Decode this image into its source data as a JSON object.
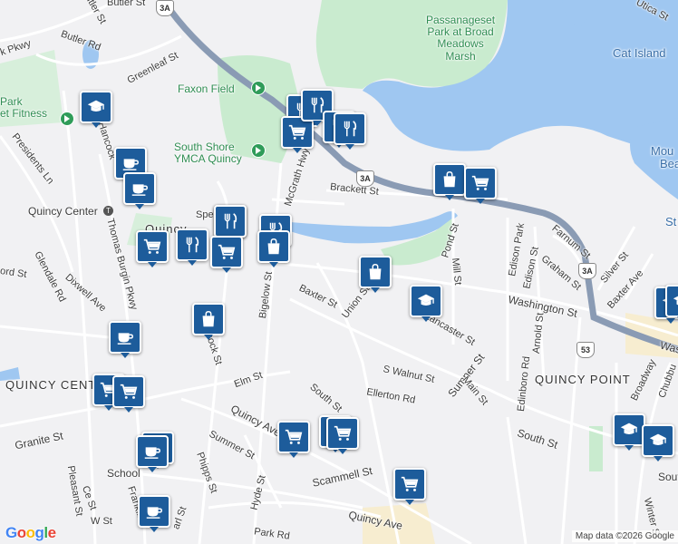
{
  "attribution": "Map data ©2026 Google",
  "logo": [
    "G",
    "o",
    "o",
    "g",
    "l",
    "e"
  ],
  "shields": {
    "3a_top": "3A",
    "3a_mid": "3A",
    "3a_right": "3A",
    "53": "53"
  },
  "areas": {
    "quincy_center": "Quincy Center",
    "quincy": "Quincy",
    "quincy_center2": "QUINCY CENTER",
    "quincy_point": "QUINCY POINT"
  },
  "parks": {
    "passanageset": "Passanageset\nPark at Broad\nMeadows\nMarsh",
    "faxon": "Faxon Field",
    "ymca": "South Shore\nYMCA Quincy",
    "fitness": "Park\net Fitness"
  },
  "water": {
    "cat_island": "Cat Island",
    "mou": "Mou",
    "bea": "Bea",
    "st": "St"
  },
  "streets": {
    "butler_st": "Butler St",
    "butler_rd": "Butler Rd",
    "k_pkwy": "k Pkwy",
    "greenleaf": "Greenleaf St",
    "hancock": "Hancock",
    "presidents": "Presidents Ln",
    "thomas_burgin": "Thomas Burgin Pkwy",
    "mcgrath": "McGrath Hwy",
    "brackett": "Brackett St",
    "washington": "Washington St",
    "washington2": "Wash",
    "pond": "Pond St",
    "mill": "Mill St",
    "edison_park": "Edison Park",
    "edison": "Edison St",
    "farnum": "Farnum St",
    "graham": "Graham St",
    "silver": "Silver St",
    "baxter_ave": "Baxter Ave",
    "baxter_st": "Baxter St",
    "union": "Union St",
    "bigelow": "Bigelow St",
    "lancaster": "Lancaster St",
    "s_walnut": "S Walnut St",
    "sumner": "Sumner St",
    "main": "Main St",
    "ellerton": "Ellerton Rd",
    "arnold": "Arnold St",
    "edinboro": "Edinboro Rd",
    "broadway": "Broadway",
    "chubbuck": "Chubbu",
    "south_st": "South St",
    "south_st2": "South St",
    "south_right": "South",
    "elm": "Elm St",
    "quincy_ave": "Quincy Ave",
    "quincy_ave2": "Quincy Ave",
    "summer": "Summer St",
    "phipps": "Phipps St",
    "hyde": "Hyde St",
    "scammell": "Scammell St",
    "school": "School",
    "granite": "Granite St",
    "pleasant": "Pleasant St",
    "franklin": "Franklin",
    "park_rd": "Park Rd",
    "winter": "Winter St",
    "glendale": "Glendale Rd",
    "dixwell": "Dixwell Ave",
    "ford": "ord St",
    "hancock_st": "Hancock St",
    "utica": "Utica St",
    "spear": "Spe",
    "carl": "arl St",
    "centre": "Ce St",
    "ws": "W St"
  },
  "markers": [
    {
      "type": "school-icon"
    },
    {
      "type": "coffee-icon"
    },
    {
      "type": "coffee-icon"
    },
    {
      "type": "school-icon"
    },
    {
      "type": "restaurant-icon"
    },
    {
      "type": "shopping-cart-icon"
    },
    {
      "type": "restaurant-icon"
    },
    {
      "type": "restaurant-icon"
    },
    {
      "type": "shopping-bag-icon"
    },
    {
      "type": "shopping-cart-icon"
    },
    {
      "type": "restaurant-icon"
    },
    {
      "type": "shopping-bag-icon"
    },
    {
      "type": "shopping-cart-icon"
    },
    {
      "type": "restaurant-icon"
    },
    {
      "type": "restaurant-icon"
    },
    {
      "type": "shopping-cart-icon"
    },
    {
      "type": "shopping-cart-icon"
    },
    {
      "type": "restaurant-icon"
    },
    {
      "type": "shopping-bag-icon"
    },
    {
      "type": "shopping-bag-icon"
    },
    {
      "type": "school-icon"
    },
    {
      "type": "coffee-icon"
    },
    {
      "type": "shopping-cart-icon"
    },
    {
      "type": "shopping-cart-icon"
    },
    {
      "type": "shopping-cart-icon"
    },
    {
      "type": "coffee-icon"
    },
    {
      "type": "shopping-cart-icon"
    },
    {
      "type": "shopping-cart-icon"
    },
    {
      "type": "shopping-cart-icon"
    },
    {
      "type": "coffee-icon"
    },
    {
      "type": "school-icon"
    },
    {
      "type": "school-icon"
    },
    {
      "type": "school-icon"
    },
    {
      "type": "shopping-cart-icon"
    }
  ],
  "colors": {
    "marker": "#1d5c9b",
    "water": "#9fc7f1",
    "park": "#c9ebcf",
    "highway": "#8a9bb4",
    "land": "#f1f1f3"
  }
}
